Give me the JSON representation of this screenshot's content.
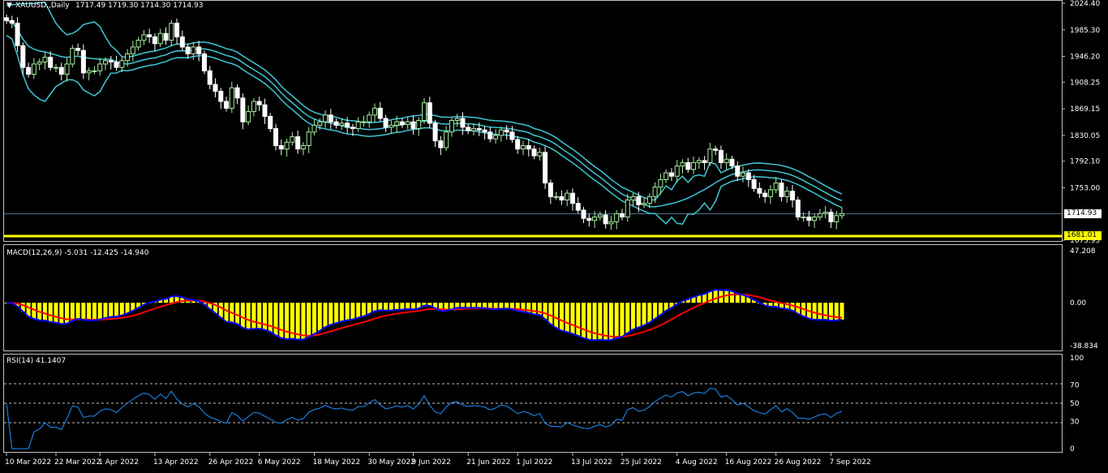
{
  "symbol_header": {
    "arrow": "▼",
    "title": "XAUUSD,,Daily",
    "ohlc": "1717.49 1719.30 1714.30 1714.93"
  },
  "macd_header": "MACD(12,26,9) -5.031 -12.425 -14.940",
  "rsi_header": "RSI(14) 41.1407",
  "price_marker": "1714.93",
  "level_marker": "1681.01",
  "colors": {
    "background": "#000000",
    "bull": "#a8f0a0",
    "bear": "#ffffff",
    "bands": "#3fc6d6",
    "level_line": "#ffff00",
    "macd_hist": "#ffff00",
    "macd_main": "#0000ff",
    "macd_signal": "#ff0000",
    "rsi_line": "#1e90ff",
    "rsi_levels": "#c0c0c0"
  },
  "chart_data": [
    {
      "type": "candlestick",
      "title": "XAUUSD,,Daily",
      "y_ticks": [
        "2024.40",
        "1985.30",
        "1946.20",
        "1908.25",
        "1869.15",
        "1830.05",
        "1792.10",
        "1753.00",
        "1714.93",
        "1681.01",
        "1675.95"
      ],
      "ylim": [
        1675.95,
        2024.4
      ],
      "x_ticks": [
        "10 Mar 2022",
        "22 Mar 2022",
        "1 Apr 2022",
        "13 Apr 2022",
        "26 Apr 2022",
        "6 May 2022",
        "18 May 2022",
        "30 May 2022",
        "9 Jun 2022",
        "21 Jun 2022",
        "1 Jul 2022",
        "13 Jul 2022",
        "25 Jul 2022",
        "4 Aug 2022",
        "16 Aug 2022",
        "26 Aug 2022",
        "7 Sep 2022"
      ],
      "close": [
        1999,
        1995,
        1962,
        1930,
        1920,
        1935,
        1938,
        1945,
        1930,
        1930,
        1920,
        1935,
        1958,
        1955,
        1922,
        1925,
        1925,
        1935,
        1940,
        1938,
        1930,
        1940,
        1950,
        1960,
        1970,
        1978,
        1975,
        1965,
        1980,
        1970,
        1995,
        1975,
        1960,
        1950,
        1960,
        1950,
        1925,
        1905,
        1895,
        1880,
        1870,
        1900,
        1885,
        1850,
        1865,
        1880,
        1875,
        1858,
        1840,
        1815,
        1810,
        1820,
        1828,
        1810,
        1815,
        1835,
        1845,
        1850,
        1860,
        1850,
        1845,
        1848,
        1842,
        1840,
        1850,
        1850,
        1860,
        1870,
        1855,
        1842,
        1845,
        1850,
        1846,
        1850,
        1840,
        1852,
        1878,
        1848,
        1822,
        1812,
        1835,
        1852,
        1855,
        1842,
        1837,
        1840,
        1838,
        1835,
        1825,
        1830,
        1838,
        1835,
        1824,
        1810,
        1815,
        1810,
        1800,
        1805,
        1760,
        1740,
        1740,
        1735,
        1745,
        1730,
        1720,
        1708,
        1705,
        1710,
        1713,
        1700,
        1703,
        1715,
        1710,
        1735,
        1740,
        1728,
        1730,
        1740,
        1754,
        1765,
        1775,
        1770,
        1785,
        1790,
        1780,
        1790,
        1793,
        1790,
        1810,
        1808,
        1790,
        1795,
        1785,
        1770,
        1775,
        1765,
        1752,
        1745,
        1740,
        1750,
        1760,
        1740,
        1748,
        1735,
        1710,
        1710,
        1705,
        1710,
        1715,
        1717,
        1703,
        1712,
        1715
      ],
      "bands_upper": [
        2021,
        2022,
        2023,
        2024,
        2024,
        2024,
        2025,
        2026,
        2010,
        1995,
        1985,
        1978,
        1980,
        1985,
        1993,
        1995,
        1997,
        1990,
        1975,
        1962,
        1955,
        1945,
        1938,
        1932,
        1925,
        1918,
        1912,
        1900,
        1890,
        1880,
        1875,
        1872,
        1872,
        1874,
        1875,
        1876,
        1877,
        1878,
        1878,
        1879,
        1880,
        1880,
        1878,
        1875,
        1870,
        1873,
        1874,
        1876,
        1877,
        1875,
        1872,
        1860,
        1850,
        1835,
        1825,
        1822,
        1822,
        1820,
        1821,
        1823,
        1822,
        1823,
        1822,
        1812,
        1814,
        1815,
        1816,
        1822,
        1817,
        1807,
        1807,
        1811,
        1812,
        1817,
        1821,
        1827,
        1825,
        1830,
        1826,
        1812,
        1818,
        1830,
        1834,
        1826,
        1822,
        1826,
        1824,
        1820,
        1811,
        1814,
        1822,
        1818,
        1808,
        1794,
        1798,
        1792,
        1780,
        1785,
        1740,
        1720,
        1720,
        1714,
        1725,
        1710,
        1700,
        1688,
        1684,
        1688,
        1692,
        1680,
        1682,
        1695,
        1690,
        1715,
        1720,
        1708,
        1710,
        1718,
        1730,
        1745,
        1756,
        1750,
        1763,
        1770,
        1761,
        1770,
        1772,
        1770,
        1790,
        1788,
        1771,
        1775,
        1766,
        1750,
        1755,
        1745,
        1735,
        1726,
        1720,
        1730,
        1740,
        1721,
        1730,
        1716,
        1690,
        1690,
        1685,
        1690,
        1696,
        1700,
        1685,
        1694,
        1697
      ]
    },
    {
      "type": "bar+line",
      "title": "MACD(12,26,9)",
      "y_ticks": [
        "47.208",
        "0.00",
        "-38.834"
      ],
      "ylim": [
        -38.834,
        47.208
      ]
    },
    {
      "type": "line",
      "title": "RSI(14)",
      "y_ticks": [
        "100",
        "70",
        "50",
        "30",
        "0"
      ],
      "ylim": [
        0,
        100
      ],
      "levels": [
        70,
        50,
        30
      ],
      "value": 41.1407
    }
  ]
}
